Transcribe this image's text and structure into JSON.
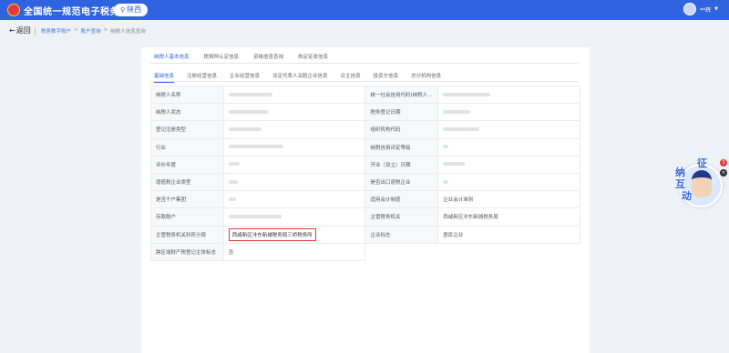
{
  "header": {
    "title": "全国统一规范电子税务局",
    "region": "陕西",
    "user_name": "**辉"
  },
  "nav": {
    "back_label": "返回",
    "breadcrumb": [
      "税务数字账户",
      "账户查询",
      "纳税人信息查询"
    ]
  },
  "main_tabs": [
    "纳税人基本信息",
    "税费种认定信息",
    "资格信息查询",
    "核定征收信息"
  ],
  "sub_tabs": [
    "基础信息",
    "注册经营信息",
    "企业经营信息",
    "法定代表人关联企业信息",
    "业主信息",
    "投资方信息",
    "总分机构信息"
  ],
  "table": {
    "rows": [
      {
        "l1": "纳税人名称",
        "v1": "",
        "l2": "统一社会信用代码(纳税人...",
        "v2": ""
      },
      {
        "l1": "纳税人状态",
        "v1": "",
        "l2": "税务登记日期",
        "v2": ""
      },
      {
        "l1": "登记注册类型",
        "v1": "",
        "l2": "组织机构代码",
        "v2": ""
      },
      {
        "l1": "行业",
        "v1": "",
        "l2": "纳税信用评定等级",
        "v2": ""
      },
      {
        "l1": "评价年度",
        "v1": "",
        "l2": "开业（设立）日期",
        "v2": ""
      },
      {
        "l1": "增值税企业类型",
        "v1": "",
        "l2": "是否出口退税企业",
        "v2": ""
      },
      {
        "l1": "是否千户集团",
        "v1": "",
        "l2": "适用会计制度",
        "v2": "企业会计准则"
      },
      {
        "l1": "存款账户",
        "v1": "",
        "l2": "主管税务机关",
        "v2": "西咸新区沣东新城税务局"
      },
      {
        "l1": "主管税务机关科所分局",
        "v1": "西咸新区沣东新城税务局三桥税务所",
        "l2": "企业标志",
        "v2": "居民企业"
      },
      {
        "l1": "跨区域财产税登记主体标志",
        "v1": "否",
        "l2": "",
        "v2": ""
      }
    ]
  },
  "widget": {
    "chars": [
      "征",
      "纳",
      "互",
      "动"
    ],
    "badge_count": "3"
  },
  "colors": {
    "brand": "#2f63e0",
    "highlight": "#e53935"
  }
}
